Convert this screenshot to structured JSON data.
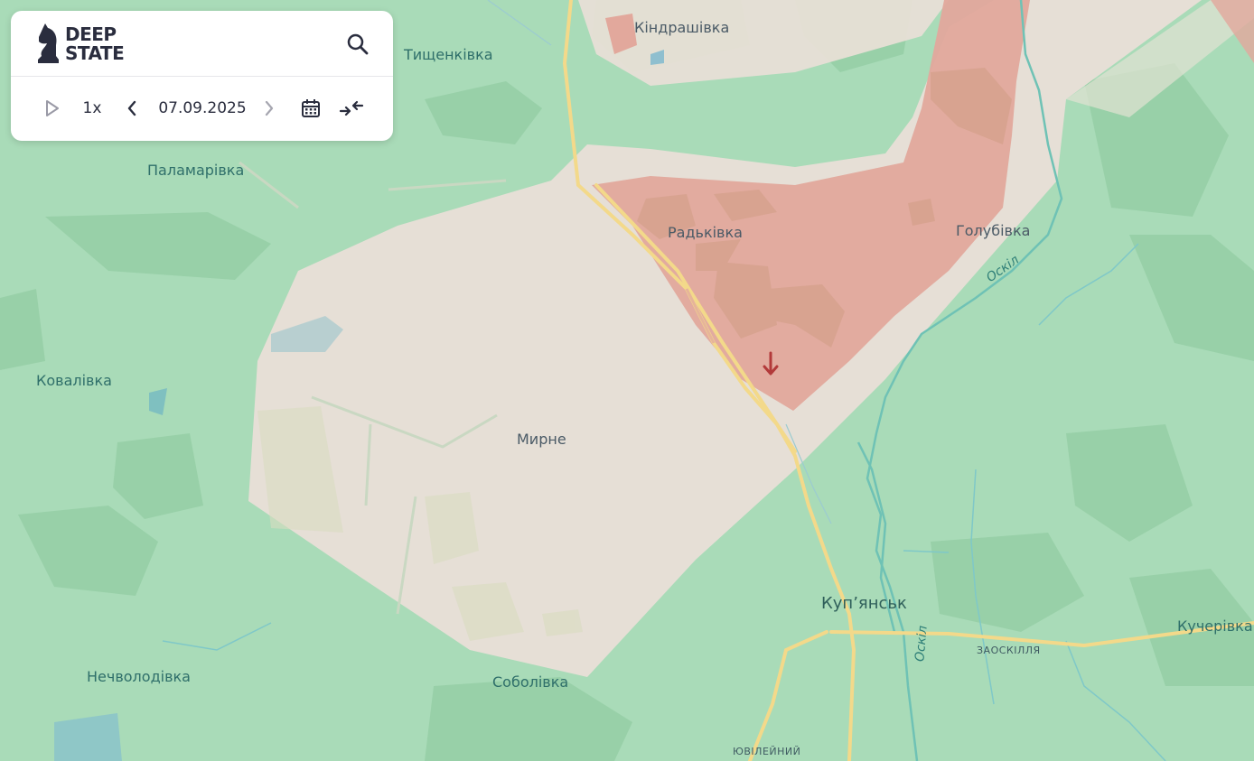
{
  "app": {
    "logo_line1": "DEEP",
    "logo_line2": "STATE"
  },
  "controls": {
    "speed": "1x",
    "date": "07.09.2025"
  },
  "map": {
    "colors": {
      "controlled": "#a9dbb8",
      "gray_zone": "#e9dfd7",
      "occupied": "#e2a89c",
      "river": "#6fc2b5",
      "road": "#f3d98a"
    },
    "places": {
      "kindrashivka": "Кіндрашівка",
      "tyshchenkivka": "Тищенківка",
      "palamarivka": "Паламарівка",
      "radkivka": "Радьківка",
      "holubivka": "Голубівка",
      "kovalivka": "Ковалівка",
      "myrne": "Мирне",
      "kupiansk": "Куп’янськ",
      "kucherivka": "Кучерівка",
      "zaoskillia": "ЗАОСКІЛЛЯ",
      "nechvolodivka": "Нечволодівка",
      "sobolivka": "Соболівка",
      "yuvileinyi": "ЮВІЛЕЙНИЙ"
    },
    "rivers": {
      "oskil_upper": "Оскіл",
      "oskil_lower": "Оскіл"
    }
  }
}
